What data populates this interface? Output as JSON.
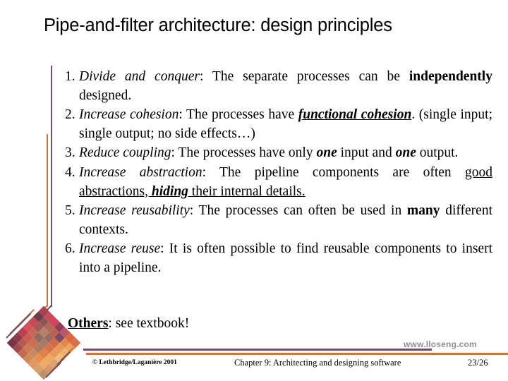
{
  "slide": {
    "title": "Pipe-and-filter architecture: design principles",
    "items": [
      {
        "number": "1.",
        "runs": [
          {
            "text": "Divide and conquer",
            "style": "italic"
          },
          {
            "text": ": The separate processes can be ",
            "style": "normal"
          },
          {
            "text": "independently",
            "style": "bold"
          },
          {
            "text": " designed.",
            "style": "normal"
          }
        ]
      },
      {
        "number": "2.",
        "runs": [
          {
            "text": "Increase cohesion",
            "style": "italic"
          },
          {
            "text": ": The processes have ",
            "style": "normal"
          },
          {
            "text": "functional cohesion",
            "style": "bold-italic-underline"
          },
          {
            "text": ". (single input; single output; no side effects…)",
            "style": "normal"
          }
        ]
      },
      {
        "number": "3.",
        "runs": [
          {
            "text": "Reduce coupling",
            "style": "italic"
          },
          {
            "text": ": The processes have only ",
            "style": "normal"
          },
          {
            "text": "one",
            "style": "bold-italic"
          },
          {
            "text": " input and ",
            "style": "normal"
          },
          {
            "text": "one",
            "style": "bold-italic"
          },
          {
            "text": " output.",
            "style": "normal"
          }
        ]
      },
      {
        "number": "4.",
        "runs": [
          {
            "text": "Increase abstraction",
            "style": "italic"
          },
          {
            "text": ": The pipeline components are often ",
            "style": "normal"
          },
          {
            "text": "good abstractions, ",
            "style": "underline"
          },
          {
            "text": "hiding",
            "style": "bold-italic-underline"
          },
          {
            "text": " their internal details.",
            "style": "underline"
          }
        ]
      },
      {
        "number": "5.",
        "runs": [
          {
            "text": "Increase reusability",
            "style": "italic"
          },
          {
            "text": ": The processes can often be used in ",
            "style": "normal"
          },
          {
            "text": "many",
            "style": "bold"
          },
          {
            "text": " different contexts.",
            "style": "normal"
          }
        ]
      },
      {
        "number": "6.",
        "runs": [
          {
            "text": "Increase reuse",
            "style": "italic"
          },
          {
            "text": ": It is often possible to find reusable components to insert into a pipeline.",
            "style": "normal"
          }
        ]
      }
    ],
    "others": {
      "label": "Others",
      "rest": ":  see textbook!"
    }
  },
  "footer": {
    "watermark": "www.lloseng.com",
    "copyright": "© Lethbridge/Laganière 2001",
    "chapter": "Chapter 9: Architecting and designing software",
    "page": "23/26"
  },
  "colors": {
    "purple": "#6b5268",
    "orange": "#c8783c",
    "watermark_gray": "#8e8e95",
    "text": "#000000",
    "background": "#ffffff"
  },
  "quilt": {
    "cells": [
      "#a8424f",
      "#c94a5a",
      "#d0455e",
      "#8e3f55",
      "#b8566a",
      "#e0663f",
      "#d9724a",
      "#6d3a4a",
      "#8d5550",
      "#b06a58",
      "#c06050",
      "#7a4a60",
      "#e08a4a",
      "#efa35c",
      "#c44a54",
      "#a35a56",
      "#b8806a",
      "#9d6a60",
      "#d06a4a",
      "#e59a55",
      "#f0b070",
      "#d8505a",
      "#c26a58",
      "#8f6a62",
      "#a57a68",
      "#d8724c",
      "#e89a58",
      "#f2bb7e",
      "#b84050",
      "#d15a50",
      "#c87050",
      "#b07a62",
      "#e08048",
      "#efa860",
      "#e0a070",
      "#8e3a4c",
      "#b85a4e",
      "#d07a52",
      "#c98a5e",
      "#e89050",
      "#f0aa66",
      "#d89a6a",
      "#7a3448",
      "#a04a4e",
      "#c06a50",
      "#d08a5a",
      "#e09a60",
      "#d8a070",
      "#c08e68"
    ]
  }
}
